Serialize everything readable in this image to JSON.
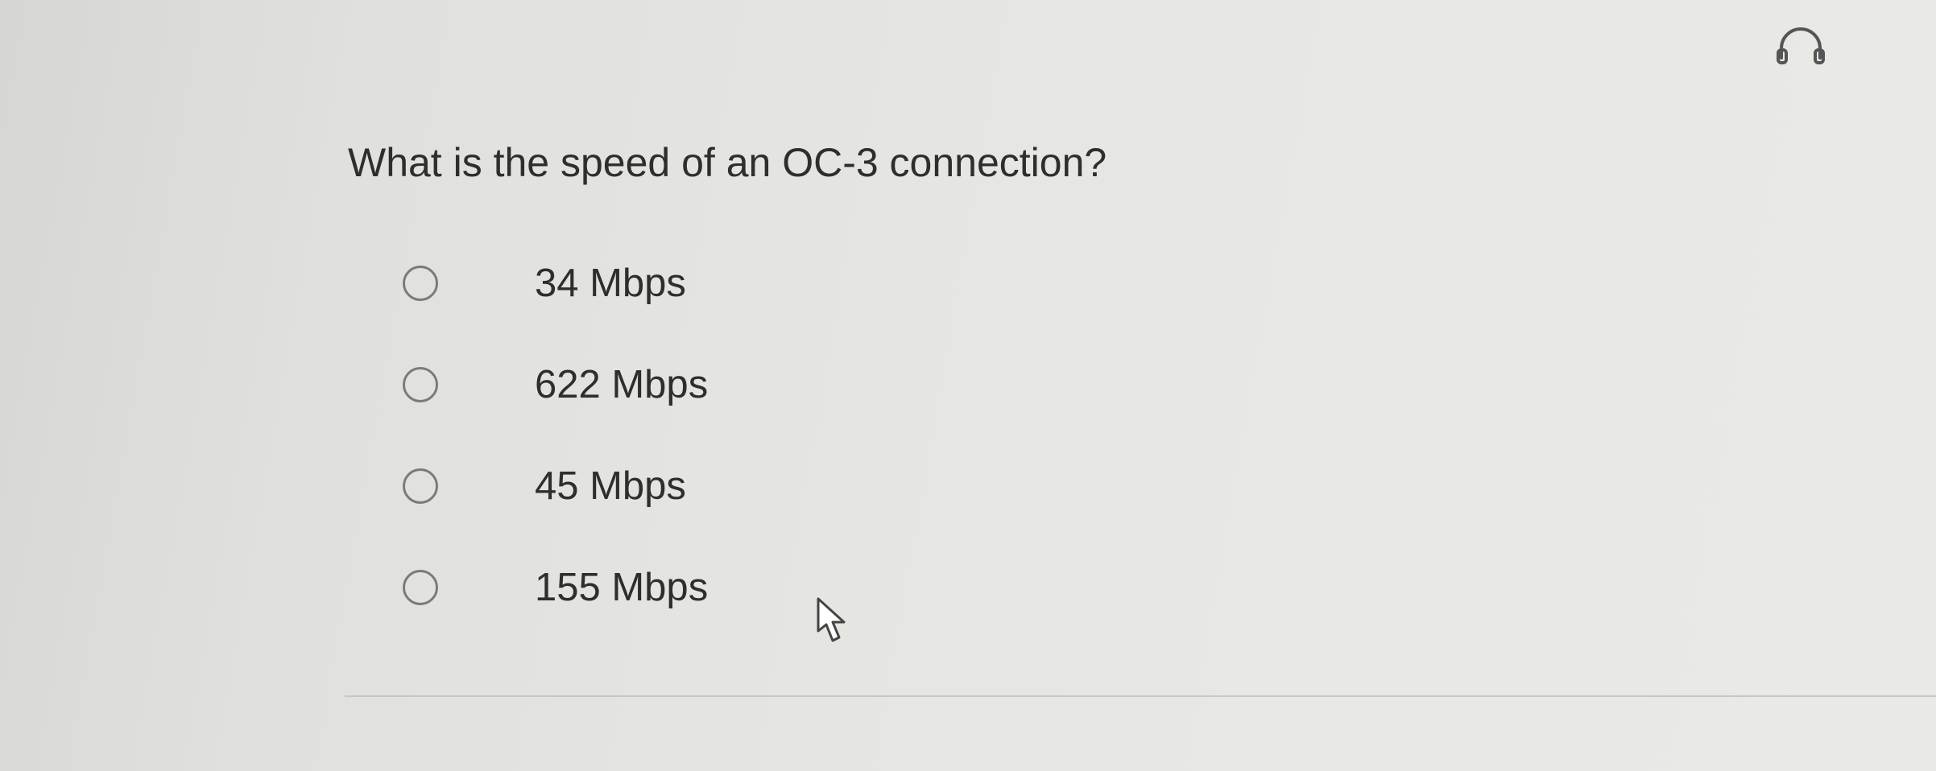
{
  "quiz": {
    "question": "What is the speed of an OC-3 connection?",
    "options": [
      {
        "label": "34 Mbps",
        "selected": false
      },
      {
        "label": "622 Mbps",
        "selected": false
      },
      {
        "label": "45 Mbps",
        "selected": false
      },
      {
        "label": "155 Mbps",
        "selected": false
      }
    ]
  },
  "toolbar": {
    "audio_icon": "headphones-icon"
  },
  "pointer": {
    "icon": "mouse-pointer-icon"
  }
}
